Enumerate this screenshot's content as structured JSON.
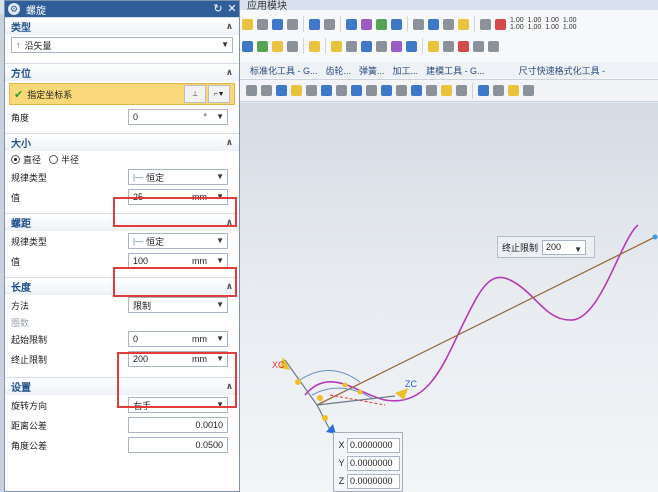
{
  "app": {
    "title_fragment": "应用模块"
  },
  "ribbon": {
    "numbers": [
      "1.00\n1.00",
      "1.00\n1.00",
      "1.00\n1.00",
      "1.00\n1.00"
    ],
    "group_labels": [
      "标准化工具 - G...",
      "齿轮...",
      "弹簧...",
      "加工...",
      "建模工具 - G...",
      "尺寸快速格式化工具 -"
    ]
  },
  "dialog": {
    "title": "螺旋",
    "icons": {
      "title": "gear-icon",
      "reset": "reset-icon",
      "close": "close-icon"
    },
    "type_section": {
      "header": "类型",
      "selected": "沿矢量"
    },
    "orientation_section": {
      "header": "方位",
      "specify_csys": "指定坐标系",
      "angle_label": "角度",
      "angle_value": "0",
      "angle_unit": "°"
    },
    "size_section": {
      "header": "大小",
      "radio_diameter": "直径",
      "radio_radius": "半径",
      "selected_radio": "直径",
      "law_type_label": "规律类型",
      "law_type_value": "恒定",
      "value_label": "值",
      "value": "25",
      "unit": "mm"
    },
    "pitch_section": {
      "header": "螺距",
      "law_type_label": "规律类型",
      "law_type_value": "恒定",
      "value_label": "值",
      "value": "100",
      "unit": "mm"
    },
    "length_section": {
      "header": "长度",
      "method_label": "方法",
      "method_value": "限制",
      "turns_label": "圈数",
      "start_label": "起始限制",
      "start_value": "0",
      "start_unit": "mm",
      "end_label": "终止限制",
      "end_value": "200",
      "end_unit": "mm"
    },
    "settings_section": {
      "header": "设置",
      "rotation_label": "旋转方向",
      "rotation_value": "右手",
      "dist_tol_label": "距离公差",
      "dist_tol_value": "0.0010",
      "angle_tol_label": "角度公差",
      "angle_tol_value": "0.0500"
    }
  },
  "viewport": {
    "end_limit_label": "终止限制",
    "end_limit_value": "200",
    "axis_xc": "XC",
    "axis_zc": "ZC",
    "coords": {
      "x_label": "X",
      "x": "0.0000000",
      "y_label": "Y",
      "y": "0.0000000",
      "z_label": "Z",
      "z": "0.0000000"
    },
    "helix_color": "#b53bb5",
    "vector_color": "#9b6a3a"
  },
  "annotation": {
    "box_color": "#e03c3c"
  }
}
